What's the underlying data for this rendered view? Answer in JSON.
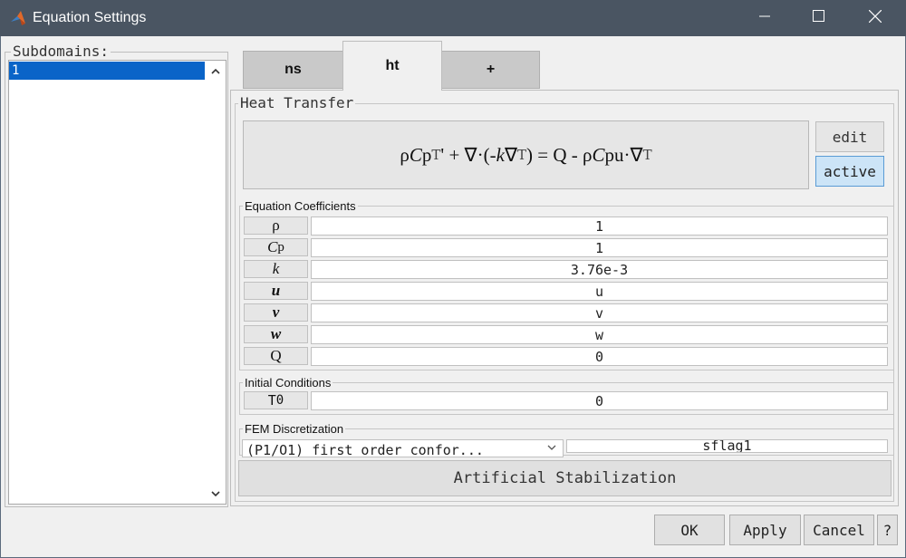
{
  "window": {
    "title": "Equation Settings",
    "controls": {
      "minimize": "minimize-icon",
      "maximize": "maximize-icon",
      "close": "close-icon"
    }
  },
  "subdomains": {
    "label": "Subdomains:",
    "items": [
      "1"
    ],
    "selected": "1"
  },
  "tabs": [
    {
      "label": "ns"
    },
    {
      "label": "ht",
      "active": true
    },
    {
      "label": "+"
    }
  ],
  "heat_transfer": {
    "label": "Heat Transfer",
    "equation": {
      "rho": "ρ",
      "C": "C",
      "p": "p",
      "T": "T",
      "prime": "'",
      "plus": " + ",
      "nabla": "∇",
      "dot": "·",
      "open": "(-",
      "k": "k",
      "T2": "T",
      "close": ") = Q - ",
      "rho2": "ρ",
      "C2": "C",
      "p2": "p",
      "u": "u",
      "dot2": "·",
      "nabla2": "∇",
      "T3": "T"
    },
    "edit_label": "edit",
    "active_label": "active"
  },
  "equation_coefficients": {
    "label": "Equation Coefficients",
    "rows": [
      {
        "symbol": "ρ",
        "value": "1"
      },
      {
        "symbol": "C",
        "sub": "p",
        "value": "1"
      },
      {
        "symbol": "k",
        "value": "3.76e-3"
      },
      {
        "symbol": "u",
        "value": "u"
      },
      {
        "symbol": "v",
        "value": "v"
      },
      {
        "symbol": "w",
        "value": "w"
      },
      {
        "symbol": "Q",
        "value": "0"
      }
    ]
  },
  "initial_conditions": {
    "label": "Initial Conditions",
    "rows": [
      {
        "symbol": "T",
        "sub": "0",
        "value": "0"
      }
    ]
  },
  "fem": {
    "label": "FEM Discretization",
    "selected": "(P1/O1) first order confor...",
    "flag": "sflag1"
  },
  "stabilization_label": "Artificial Stabilization",
  "buttons": {
    "ok": "OK",
    "apply": "Apply",
    "cancel": "Cancel",
    "help": "?"
  },
  "colors": {
    "titlebar": "#4a5562",
    "selection": "#0a64c8",
    "active_button": "#cce4f7"
  }
}
